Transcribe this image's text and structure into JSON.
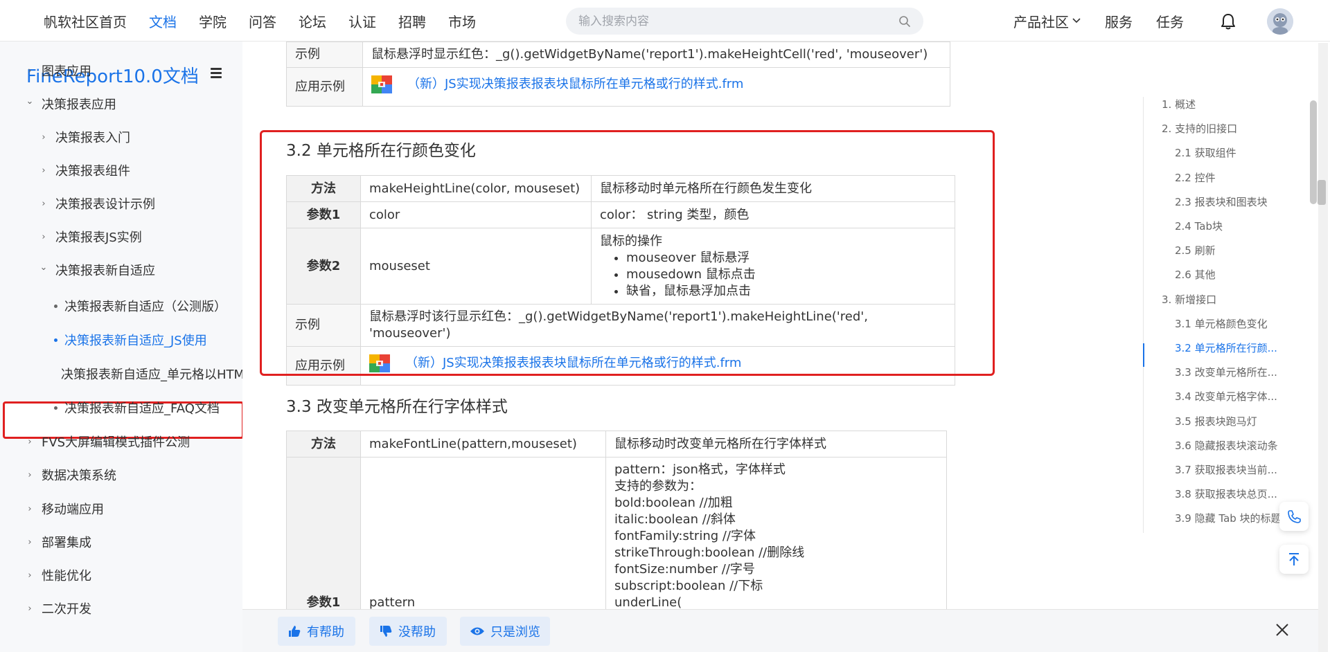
{
  "topnav": {
    "items": [
      "帆软社区首页",
      "文档",
      "学院",
      "问答",
      "论坛",
      "认证",
      "招聘",
      "市场"
    ],
    "active": "文档",
    "search_placeholder": "输入搜索内容",
    "right": [
      "产品社区",
      "服务",
      "任务"
    ]
  },
  "sidebar": {
    "title": "FineReport10.0文档",
    "items": [
      {
        "label": "图表应用",
        "kind": "collapsed"
      },
      {
        "label": "决策报表应用",
        "kind": "expanded"
      },
      {
        "label": "决策报表入门",
        "kind": "collapsed"
      },
      {
        "label": "决策报表组件",
        "kind": "collapsed"
      },
      {
        "label": "决策报表设计示例",
        "kind": "collapsed"
      },
      {
        "label": "决策报表JS实例",
        "kind": "collapsed"
      },
      {
        "label": "决策报表新自适应",
        "kind": "expanded"
      },
      {
        "label": "决策报表新自适应（公测版）",
        "kind": "leaf"
      },
      {
        "label": "决策报表新自适应_JS使用",
        "kind": "leaf-selected"
      },
      {
        "label": "决策报表新自适应_单元格以HTM",
        "kind": "leaf"
      },
      {
        "label": "决策报表新自适应_FAQ文档",
        "kind": "leaf"
      },
      {
        "label": "FVS大屏编辑模式插件公测",
        "kind": "collapsed"
      },
      {
        "label": "数据决策系统",
        "kind": "collapsed"
      },
      {
        "label": "移动端应用",
        "kind": "collapsed"
      },
      {
        "label": "部署集成",
        "kind": "collapsed"
      },
      {
        "label": "性能优化",
        "kind": "collapsed"
      },
      {
        "label": "二次开发",
        "kind": "collapsed"
      }
    ]
  },
  "top_table": {
    "example_label": "示例",
    "example_text": "鼠标悬浮时显示红色：_g().getWidgetByName('report1').makeHeightCell('red', 'mouseover')",
    "app_label": "应用示例",
    "app_link": "（新）JS实现决策报表报表块鼠标所在单元格或行的样式.frm"
  },
  "section_32": {
    "title": "3.2 单元格所在行颜色变化",
    "method_label": "方法",
    "method_sig": "makeHeightLine(color, mouseset)",
    "method_desc": "鼠标移动时单元格所在行颜色发生变化",
    "param1_label": "参数1",
    "param1_name": "color",
    "param1_desc": "color： string 类型，颜色",
    "param2_label": "参数2",
    "param2_name": "mouseset",
    "param2_desc_title": "鼠标的操作",
    "param2_ops": [
      "mouseover 鼠标悬浮",
      "mousedown 鼠标点击",
      "缺省，鼠标悬浮加点击"
    ],
    "example_label": "示例",
    "example_text": "鼠标悬浮时该行显示红色：_g().getWidgetByName('report1').makeHeightLine('red', 'mouseover')",
    "app_label": "应用示例",
    "app_link": "（新）JS实现决策报表报表块鼠标所在单元格或行的样式.frm"
  },
  "section_33": {
    "title": "3.3 改变单元格所在行字体样式",
    "method_label": "方法",
    "method_sig": "makeFontLine(pattern,mouseset)",
    "method_desc": "鼠标移动时改变单元格所在行字体样式",
    "param1_label": "参数1",
    "param1_name": "pattern",
    "param1_lines": [
      "pattern：json格式，字体样式",
      "支持的参数为：",
      "bold:boolean //加粗",
      "italic:boolean //斜体",
      "fontFamily:string //字体",
      "strikeThrough:boolean //删除线",
      "fontSize:number //字号",
      "subscript:boolean //下标",
      "underLine("
    ]
  },
  "toc": {
    "items": [
      {
        "label": "1. 概述",
        "level": 1
      },
      {
        "label": "2. 支持的旧接口",
        "level": 1
      },
      {
        "label": "2.1 获取组件",
        "level": 2
      },
      {
        "label": "2.2 控件",
        "level": 2
      },
      {
        "label": "2.3 报表块和图表块",
        "level": 2
      },
      {
        "label": "2.4 Tab块",
        "level": 2
      },
      {
        "label": "2.5 刷新",
        "level": 2
      },
      {
        "label": "2.6 其他",
        "level": 2
      },
      {
        "label": "3. 新增接口",
        "level": 1
      },
      {
        "label": "3.1 单元格颜色变化",
        "level": 2
      },
      {
        "label": "3.2 单元格所在行颜...",
        "level": 2,
        "active": true
      },
      {
        "label": "3.3 改变单元格所在...",
        "level": 2
      },
      {
        "label": "3.4 改变单元格字体...",
        "level": 2
      },
      {
        "label": "3.5 报表块跑马灯",
        "level": 2
      },
      {
        "label": "3.6 隐藏报表块滚动条",
        "level": 2
      },
      {
        "label": "3.7 获取报表块当前...",
        "level": 2
      },
      {
        "label": "3.8 获取报表块总页...",
        "level": 2
      },
      {
        "label": "3.9 隐藏 Tab 块的标题",
        "level": 2
      }
    ]
  },
  "feedback": {
    "helpful": "有帮助",
    "not_helpful": "没帮助",
    "just_browse": "只是浏览"
  },
  "colors": {
    "accent": "#1a73e8",
    "highlight": "#e02020"
  }
}
